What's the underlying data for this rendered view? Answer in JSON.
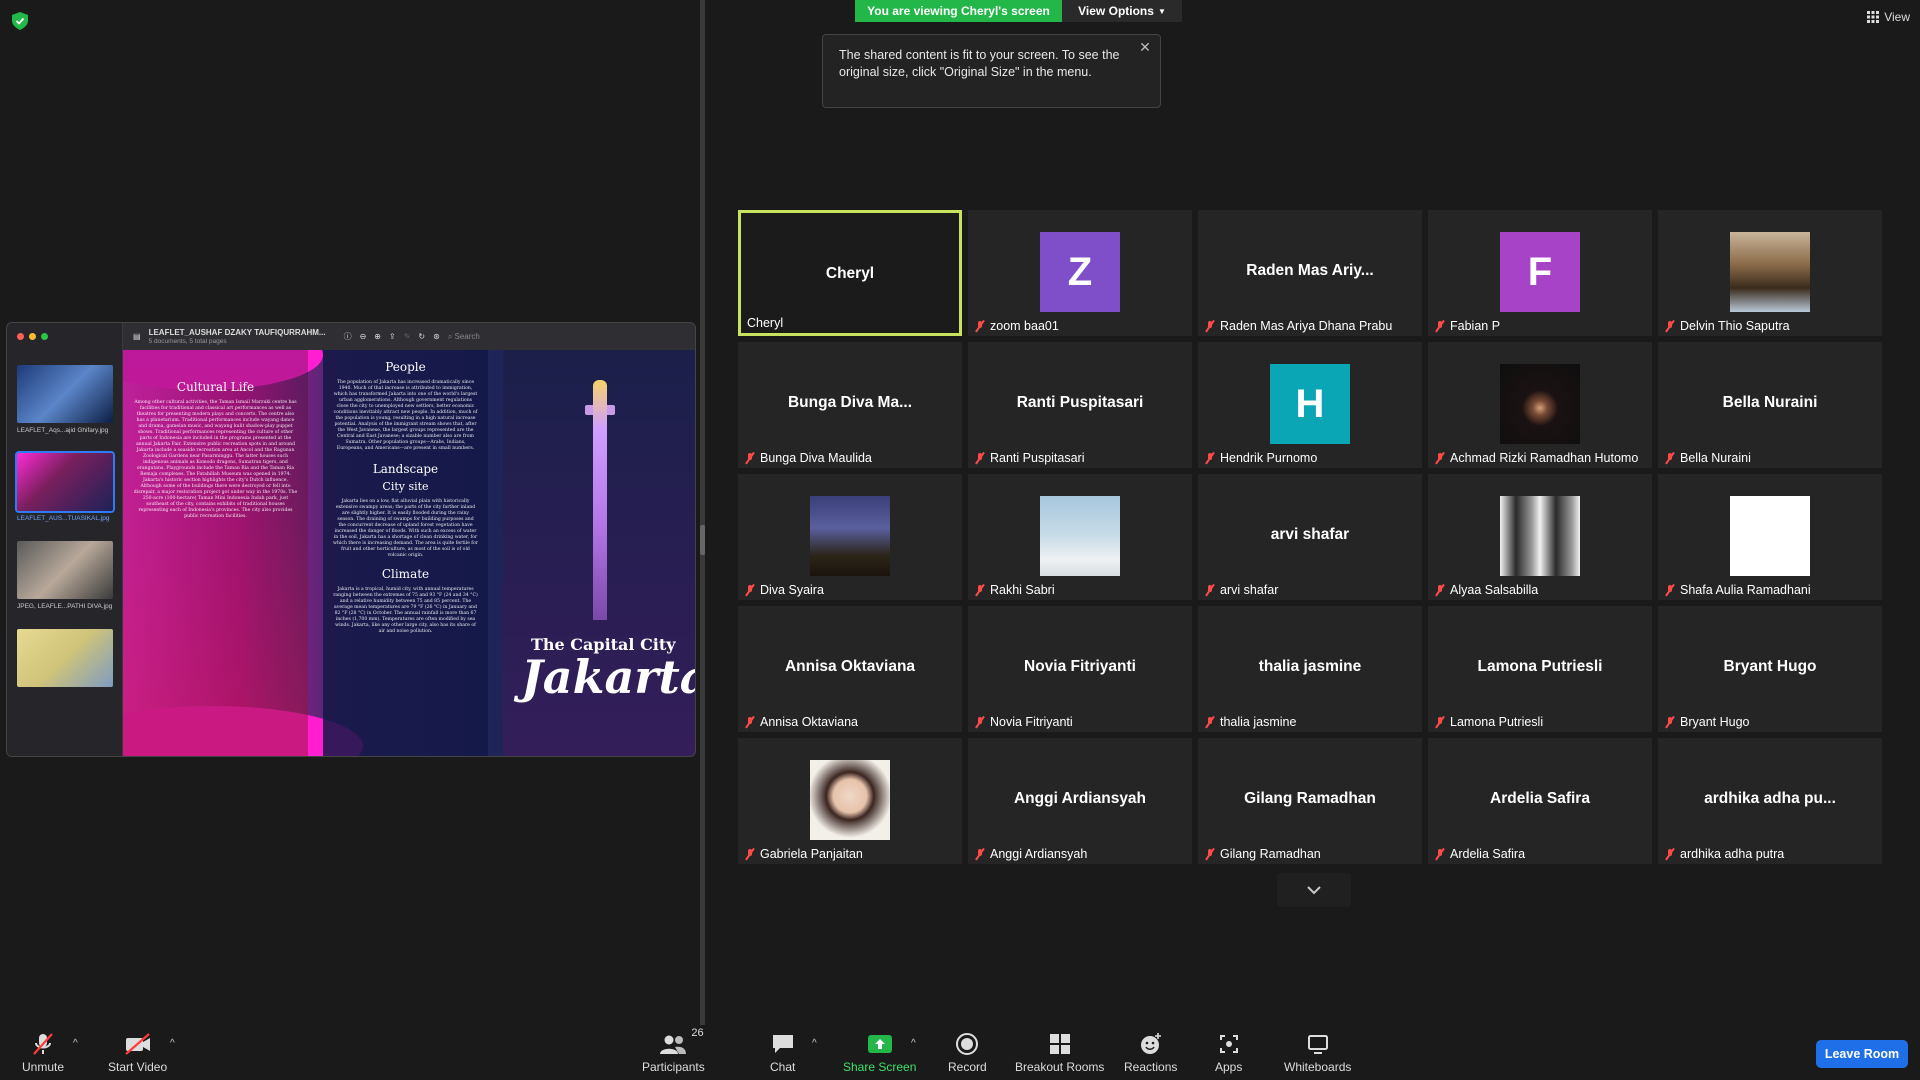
{
  "banner": {
    "viewing": "You are viewing Cheryl's screen",
    "view_options": "View Options"
  },
  "tooltip": {
    "text": "The shared content is fit to your screen. To see the original size, click \"Original Size\" in the menu."
  },
  "view_button": {
    "label": "View"
  },
  "shared_window": {
    "title": "LEAFLET_AUSHAF DZAKY TAUFIQURRAHM...",
    "subtitle": "5 documents, 5 total pages",
    "search_placeholder": "Search",
    "thumbnails": [
      {
        "caption": "LEAFLET_Aqs...ajid Ghifary.jpg"
      },
      {
        "caption": "LEAFLET_AUS...TUASIKAL.jpg"
      },
      {
        "caption": "JPEG, LEAFLE...PATHI DIVA.jpg"
      },
      {
        "caption": ""
      }
    ],
    "doc": {
      "col1_heading": "Cultural Life",
      "col1_text": "Among other cultural activities, the Taman Ismail Marzuki centre has facilities for traditional and classical art performances as well as theatres for presenting modern plays and concerts. The centre also has a planetarium. Traditional performances include wayang dance and drama, gamelan music, and wayang kulit shadow-play puppet shows. Traditional performances representing the culture of other parts of Indonesia are included in the programs presented at the annual Jakarta Fair. Extensive public recreation spots in and around Jakarta include a seaside recreation area at Ancol and the Ragunan Zoological Gardens near Pasarminggu. The latter houses such indigenous animals as Komodo dragons, Sumatran tigers, and orangutans. Playgrounds include the Taman Ria and the Taman Ria Remaja complexes. The Fatahillah Museum was opened in 1974. Jakarta's historic section highlights the city's Dutch influence. Although some of the buildings there were destroyed or fell into disrepair, a major restoration project got under way in the 1970s. The 250-acre (100-hectare) Taman Mini Indonesia Indah park, just southeast of the city, contains exhibits of traditional houses representing each of Indonesia's provinces. The city also provides public recreation facilities.",
      "col2_heading": "People",
      "col2_text": "The population of Jakarta has increased dramatically since 1940. Much of that increase is attributed to immigration, which has transformed Jakarta into one of the world's largest urban agglomerations. Although government regulations close the city to unemployed new settlers, better economic conditions inevitably attract new people. In addition, much of the population is young, resulting in a high natural increase potential. Analysis of the immigrant stream shows that, after the West Javanese, the largest groups represented are the Central and East Javanese; a sizable number also are from Sumatra. Other population groups—Arabs, Indians, Europeans, and Americans—are present in small numbers.",
      "col2_heading_b": "Landscape",
      "col2_subheading": "City site",
      "col2_text_b": "Jakarta lies on a low, flat alluvial plain with historically extensive swampy areas; the parts of the city farther inland are slightly higher. It is easily flooded during the rainy season. The draining of swamps for building purposes and the concurrent decrease of upland forest vegetation have increased the danger of floods. With such an excess of water in the soil, Jakarta has a shortage of clean drinking water, for which there is increasing demand. The area is quite fertile for fruit and other horticulture, as most of the soil is of old volcanic origin.",
      "col2_heading_c": "Climate",
      "col2_text_c": "Jakarta is a tropical, humid city, with annual temperatures ranging between the extremes of 75 and 93 °F (24 and 34 °C) and a relative humidity between 75 and 85 percent. The average mean temperatures are 79 °F (26 °C) in January and 82 °F (28 °C) in October. The annual rainfall is more than 67 inches (1,700 mm). Temperatures are often modified by sea winds. Jakarta, like any other large city, also has its share of air and noise pollution.",
      "brand_small": "The Capital City",
      "brand_big": "Jakarta"
    }
  },
  "tiles": [
    {
      "center": "Cheryl",
      "label": "Cheryl",
      "muted": false,
      "active": true,
      "avatar": null
    },
    {
      "center": "",
      "label": "zoom baa01",
      "muted": true,
      "avatar": {
        "letter": "Z",
        "color": "#7e4fc9"
      }
    },
    {
      "center": "Raden Mas Ariy...",
      "label": "Raden Mas Ariya Dhana Prabu",
      "muted": true,
      "avatar": null
    },
    {
      "center": "",
      "label": "Fabian P",
      "muted": true,
      "avatar": {
        "letter": "F",
        "color": "#a743c7"
      }
    },
    {
      "center": "",
      "label": "Delvin Thio Saputra",
      "muted": true,
      "avatar": {
        "photo": "delvin"
      }
    },
    {
      "center": "Bunga Diva Ma...",
      "label": "Bunga Diva Maulida",
      "muted": true,
      "avatar": null
    },
    {
      "center": "Ranti Puspitasari",
      "label": "Ranti Puspitasari",
      "muted": true,
      "avatar": null
    },
    {
      "center": "",
      "label": "Hendrik Purnomo",
      "muted": true,
      "avatar": {
        "letter": "H",
        "color": "#0aa6b5"
      }
    },
    {
      "center": "",
      "label": "Achmad Rizki Ramadhan Hutomo",
      "muted": true,
      "avatar": {
        "photo": "achmad"
      }
    },
    {
      "center": "Bella Nuraini",
      "label": "Bella Nuraini",
      "muted": true,
      "avatar": null
    },
    {
      "center": "",
      "label": "Diva Syaira",
      "muted": true,
      "avatar": {
        "photo": "diva"
      }
    },
    {
      "center": "",
      "label": "Rakhi Sabri",
      "muted": true,
      "avatar": {
        "photo": "rakhi"
      }
    },
    {
      "center": "arvi shafar",
      "label": "arvi shafar",
      "muted": true,
      "avatar": null
    },
    {
      "center": "",
      "label": "Alyaa Salsabilla",
      "muted": true,
      "avatar": {
        "photo": "alyaa"
      }
    },
    {
      "center": "",
      "label": "Shafa Aulia Ramadhani",
      "muted": true,
      "avatar": {
        "photo": "shafa"
      }
    },
    {
      "center": "Annisa Oktaviana",
      "label": "Annisa Oktaviana",
      "muted": true,
      "avatar": null
    },
    {
      "center": "Novia Fitriyanti",
      "label": "Novia Fitriyanti",
      "muted": true,
      "avatar": null
    },
    {
      "center": "thalia jasmine",
      "label": "thalia jasmine",
      "muted": true,
      "avatar": null
    },
    {
      "center": "Lamona Putriesli",
      "label": "Lamona Putriesli",
      "muted": true,
      "avatar": null
    },
    {
      "center": "Bryant Hugo",
      "label": "Bryant Hugo",
      "muted": true,
      "avatar": null
    },
    {
      "center": "",
      "label": "Gabriela Panjaitan",
      "muted": true,
      "avatar": {
        "photo": "gabriela"
      }
    },
    {
      "center": "Anggi Ardiansyah",
      "label": "Anggi Ardiansyah",
      "muted": true,
      "avatar": null
    },
    {
      "center": "Gilang Ramadhan",
      "label": "Gilang Ramadhan",
      "muted": true,
      "avatar": null
    },
    {
      "center": "Ardelia Safira",
      "label": "Ardelia Safira",
      "muted": true,
      "avatar": null
    },
    {
      "center": "ardhika adha pu...",
      "label": "ardhika adha putra",
      "muted": true,
      "avatar": null
    }
  ],
  "toolbar": {
    "unmute": "Unmute",
    "start_video": "Start Video",
    "participants": "Participants",
    "participants_count": "26",
    "chat": "Chat",
    "share_screen": "Share Screen",
    "record": "Record",
    "breakout_rooms": "Breakout Rooms",
    "reactions": "Reactions",
    "apps": "Apps",
    "whiteboards": "Whiteboards",
    "leave_room": "Leave Room"
  },
  "colors": {
    "active_speaker": "#c7e45c",
    "share_green": "#23b74a",
    "leave_blue": "#1f6fe8",
    "mute_red": "#ff4a4a"
  }
}
